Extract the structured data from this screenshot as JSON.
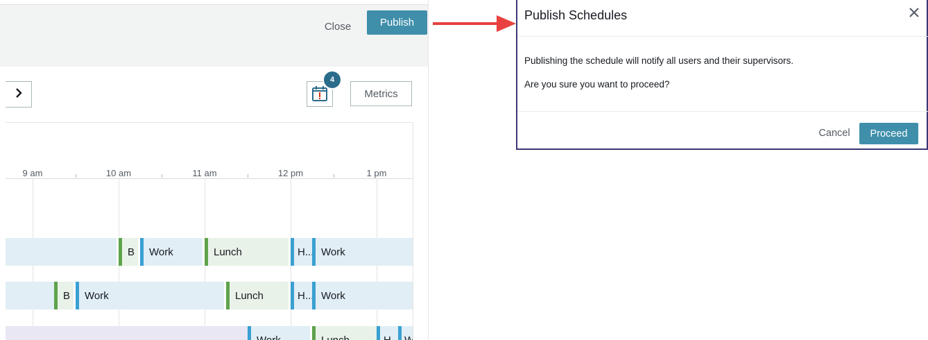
{
  "header": {
    "close_label": "Close",
    "publish_label": "Publish"
  },
  "toolbar": {
    "next_icon": "chevron-right-icon",
    "calendar_icon": "calendar-alert-icon",
    "notification_count": "4",
    "metrics_label": "Metrics"
  },
  "timeline": {
    "hours": [
      "9 am",
      "10 am",
      "11 am",
      "12 pm",
      "1 pm"
    ],
    "rows": [
      {
        "segments": [
          {
            "label": "B"
          },
          {
            "label": "Work"
          },
          {
            "label": "Lunch"
          },
          {
            "label": "H..."
          },
          {
            "label": "Work"
          }
        ]
      },
      {
        "segments": [
          {
            "label": "B"
          },
          {
            "label": "Work"
          },
          {
            "label": "Lunch"
          },
          {
            "label": "H..."
          },
          {
            "label": "Work"
          }
        ]
      },
      {
        "segments": [
          {
            "label": "Work"
          },
          {
            "label": "Lunch"
          },
          {
            "label": "H"
          },
          {
            "label": "W"
          }
        ]
      }
    ]
  },
  "modal": {
    "title": "Publish Schedules",
    "message": "Publishing the schedule will notify all users and their supervisors.",
    "question": "Are you sure you want to proceed?",
    "cancel_label": "Cancel",
    "proceed_label": "Proceed"
  },
  "colors": {
    "primary_button": "#3f8fab",
    "badge": "#2a6c8a",
    "arrow": "#e8413f",
    "break_segment_accent": "#5ea34a",
    "work_segment_accent": "#3aa0d2",
    "modal_border": "#3b3674"
  }
}
